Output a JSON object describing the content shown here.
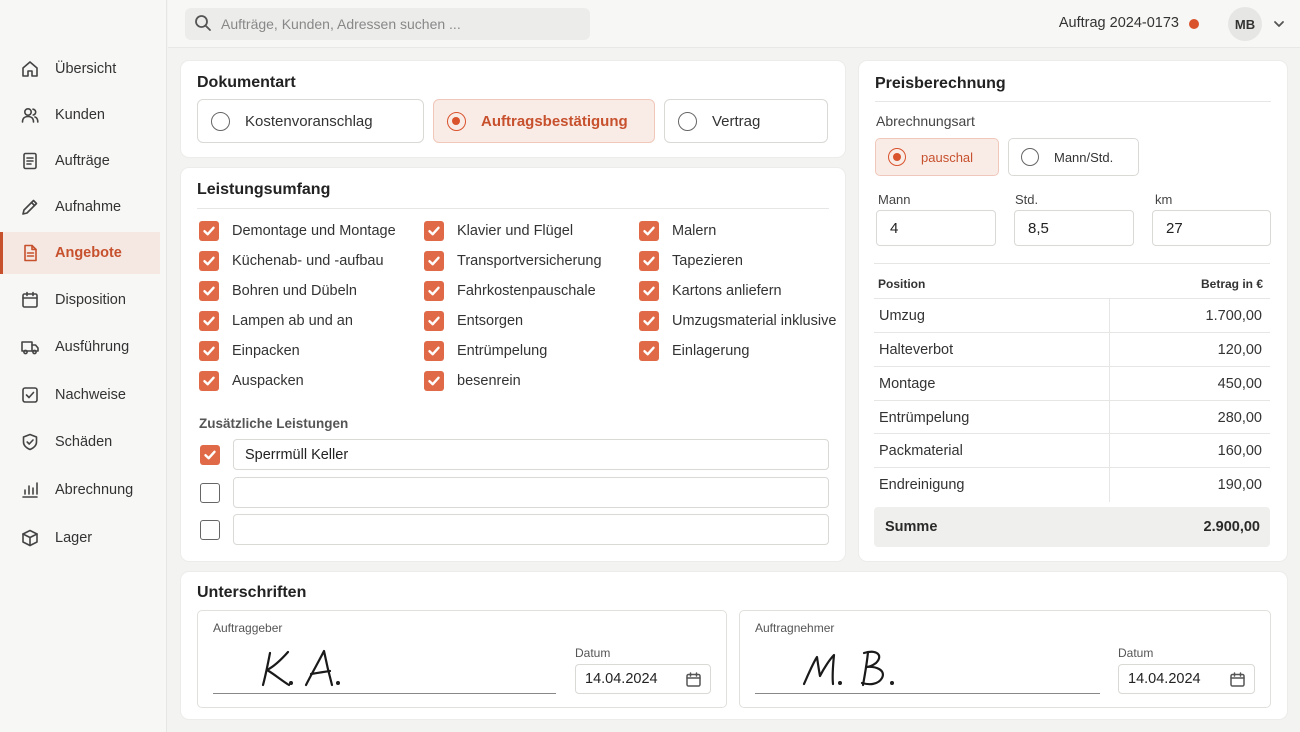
{
  "sidebar": {
    "items": [
      {
        "label": "Übersicht",
        "icon": "home-icon"
      },
      {
        "label": "Kunden",
        "icon": "users-icon"
      },
      {
        "label": "Aufträge",
        "icon": "document-icon"
      },
      {
        "label": "Aufnahme",
        "icon": "pencil-icon"
      },
      {
        "label": "Angebote",
        "icon": "offer-document-icon",
        "active": true
      },
      {
        "label": "Disposition",
        "icon": "calendar-icon"
      },
      {
        "label": "Ausführung",
        "icon": "truck-icon"
      },
      {
        "label": "Nachweise",
        "icon": "checkbox-icon"
      },
      {
        "label": "Schäden",
        "icon": "shield-icon"
      },
      {
        "label": "Abrechnung",
        "icon": "bar-chart-icon"
      },
      {
        "label": "Lager",
        "icon": "box-icon"
      }
    ]
  },
  "topbar": {
    "search_placeholder": "Aufträge, Kunden, Adressen suchen ...",
    "order_label": "Auftrag 2024-0173",
    "status_color": "#d9532d",
    "avatar_initials": "MB"
  },
  "dokumentart": {
    "title": "Dokumentart",
    "options": [
      "Kostenvoranschlag",
      "Auftragsbestätigung",
      "Vertrag"
    ],
    "selected": "Auftragsbestätigung"
  },
  "leistungsumfang": {
    "title": "Leistungsumfang",
    "col1": [
      "Demontage und Montage",
      "Küchenab- und -aufbau",
      "Bohren und Dübeln",
      "Lampen ab und an",
      "Einpacken",
      "Auspacken"
    ],
    "col2": [
      "Klavier und Flügel",
      "Transportversicherung",
      "Fahrkostenpauschale",
      "Entsorgen",
      "Entrümpelung",
      "besenrein"
    ],
    "col3": [
      "Malern",
      "Tapezieren",
      "Kartons anliefern",
      "Umzugsmaterial inklusive",
      "Einlagerung"
    ],
    "additional_label": "Zusätzliche Leistungen",
    "additional": [
      {
        "checked": true,
        "value": "Sperrmüll Keller"
      },
      {
        "checked": false,
        "value": ""
      },
      {
        "checked": false,
        "value": ""
      }
    ]
  },
  "preis": {
    "title": "Preisberechnung",
    "abrechnungsart_label": "Abrechnungsart",
    "abrechnungsart_options": [
      "pauschal",
      "Mann/Std."
    ],
    "abrechnungsart_selected": "pauschal",
    "fields": [
      {
        "label": "Mann",
        "value": "4"
      },
      {
        "label": "Std.",
        "value": "8,5"
      },
      {
        "label": "km",
        "value": "27"
      }
    ],
    "col_position": "Position",
    "col_amount": "Betrag in €",
    "rows": [
      {
        "position": "Umzug",
        "amount": "1.700,00"
      },
      {
        "position": "Halteverbot",
        "amount": "120,00"
      },
      {
        "position": "Montage",
        "amount": "450,00"
      },
      {
        "position": "Entrümpelung",
        "amount": "280,00"
      },
      {
        "position": "Packmaterial",
        "amount": "160,00"
      },
      {
        "position": "Endreinigung",
        "amount": "190,00"
      }
    ],
    "sum_label": "Summe",
    "sum_value": "2.900,00"
  },
  "unterschriften": {
    "title": "Unterschriften",
    "auftraggeber": {
      "label": "Auftraggeber",
      "signature": "K. A.",
      "date_label": "Datum",
      "date": "14.04.2024"
    },
    "auftragnehmer": {
      "label": "Auftragnehmer",
      "signature": "M. B.",
      "date_label": "Datum",
      "date": "14.04.2024"
    }
  },
  "colors": {
    "accent": "#d9532d",
    "checkbox": "#e06a47",
    "selected_bg": "#f9ece7"
  }
}
